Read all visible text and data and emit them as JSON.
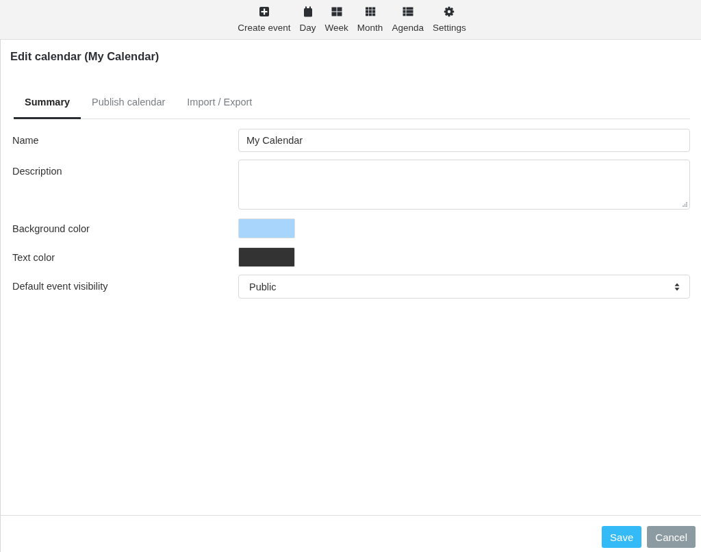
{
  "toolbar": {
    "items": [
      {
        "label": "Create event"
      },
      {
        "label": "Day"
      },
      {
        "label": "Week"
      },
      {
        "label": "Month"
      },
      {
        "label": "Agenda"
      },
      {
        "label": "Settings"
      }
    ]
  },
  "title": "Edit calendar (My Calendar)",
  "tabs": [
    {
      "label": "Summary",
      "selected": true
    },
    {
      "label": "Publish calendar",
      "selected": false
    },
    {
      "label": "Import / Export",
      "selected": false
    }
  ],
  "form": {
    "fields": [
      {
        "kind": "text",
        "label": "Name",
        "value": "My Calendar"
      },
      {
        "kind": "textarea",
        "label": "Description"
      },
      {
        "kind": "color",
        "label": "Background color",
        "color": "#a8d5fb"
      },
      {
        "kind": "color",
        "label": "Text color",
        "color": "#333333"
      },
      {
        "kind": "select",
        "label": "Default event visibility",
        "value": "Public"
      }
    ]
  },
  "buttons": [
    {
      "label": "Save",
      "kind": "primary"
    },
    {
      "label": "Cancel",
      "kind": "secondary"
    }
  ]
}
